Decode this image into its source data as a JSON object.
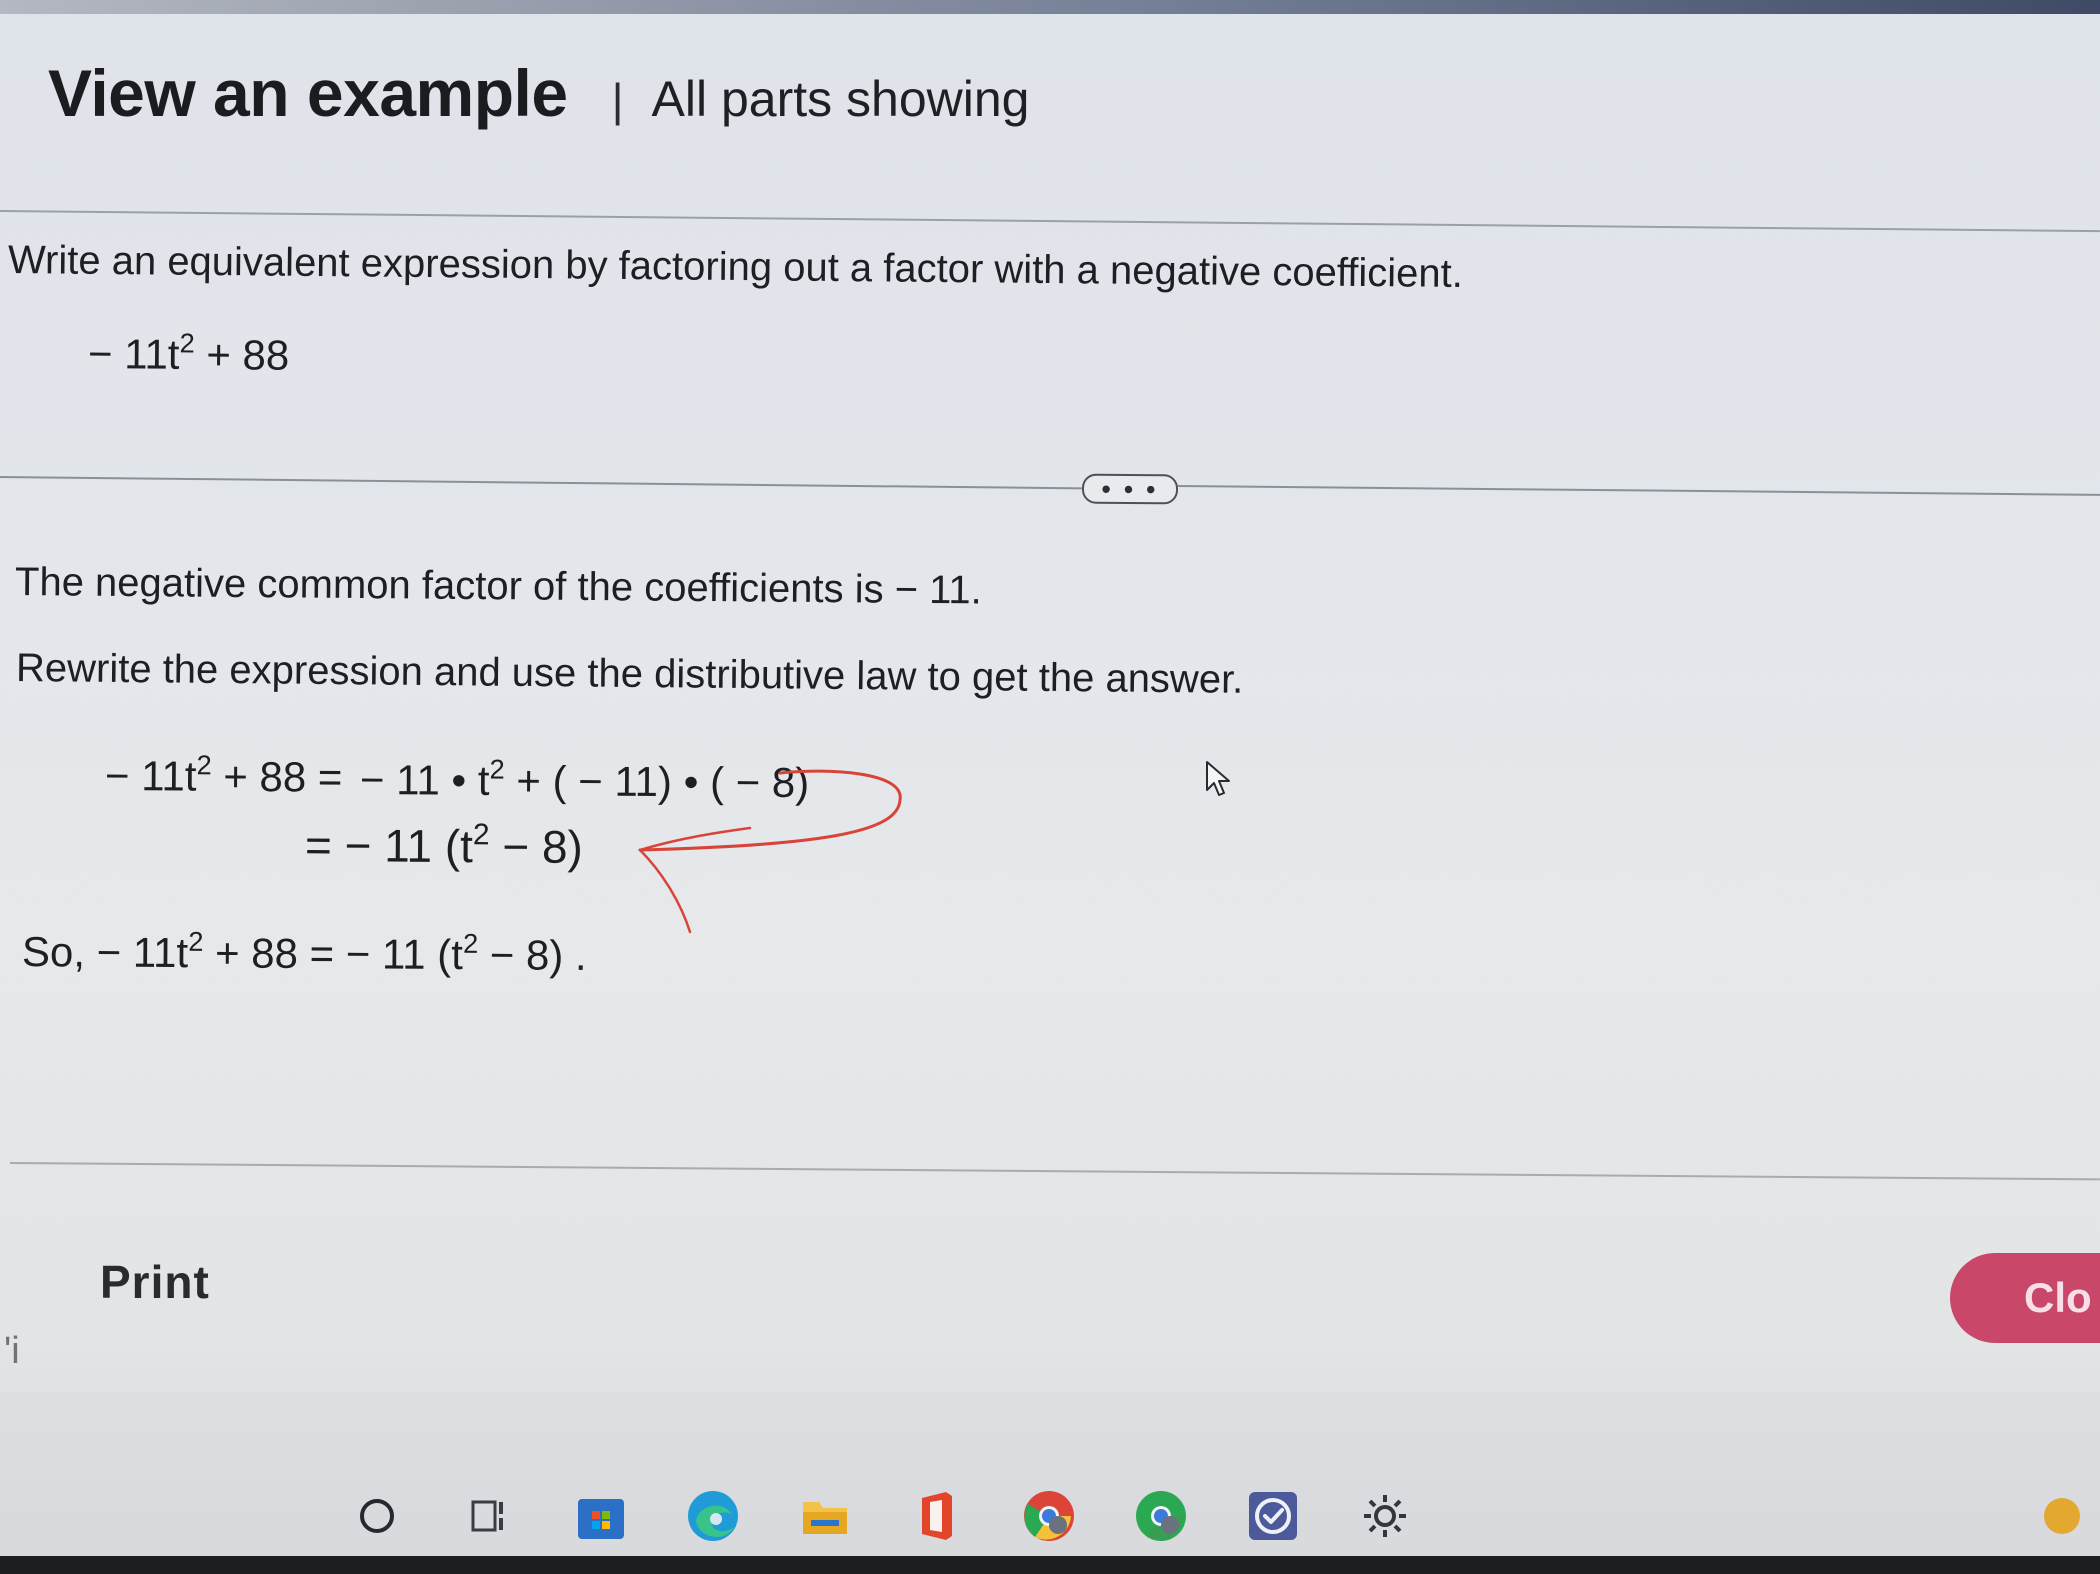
{
  "header": {
    "title": "View an example",
    "separator": "|",
    "subtitle": "All parts showing"
  },
  "question": {
    "instruction": "Write an equivalent expression by factoring out a factor with a negative coefficient.",
    "expr_a": "− 11t",
    "expr_exp": "2",
    "expr_b": " + 88"
  },
  "more_button": {
    "label": "• • •"
  },
  "solution": {
    "step1": "The negative common factor of the coefficients is  − 11.",
    "step2": "Rewrite the expression and use the distributive law to get the answer.",
    "eq1_left_a": "− 11t",
    "eq1_left_exp": "2",
    "eq1_left_b": " + 88  =",
    "eq1_right_a": "− 11 • t",
    "eq1_right_exp": "2",
    "eq1_right_b": " + ( − 11) • ( − 8)",
    "eq2_a": "=  − 11 (t",
    "eq2_exp": "2",
    "eq2_b": " − 8)",
    "so_a": "So,  − 11t",
    "so_exp": "2",
    "so_b": " + 88 =  − 11 (t",
    "so_exp2": "2",
    "so_c": " − 8) ."
  },
  "footer": {
    "print_label": "Print",
    "close_label": "Clo",
    "edge_mark": "'i"
  },
  "taskbar": {
    "icons": [
      "search-circle-icon",
      "task-view-icon",
      "store-icon",
      "edge-browser-icon",
      "file-explorer-icon",
      "office-icon",
      "chrome-icon",
      "chrome-profile-icon",
      "checkmark-app-icon",
      "settings-gear-icon"
    ]
  },
  "colors": {
    "annotation": "#d9443a",
    "close_button": "#c9486a"
  }
}
